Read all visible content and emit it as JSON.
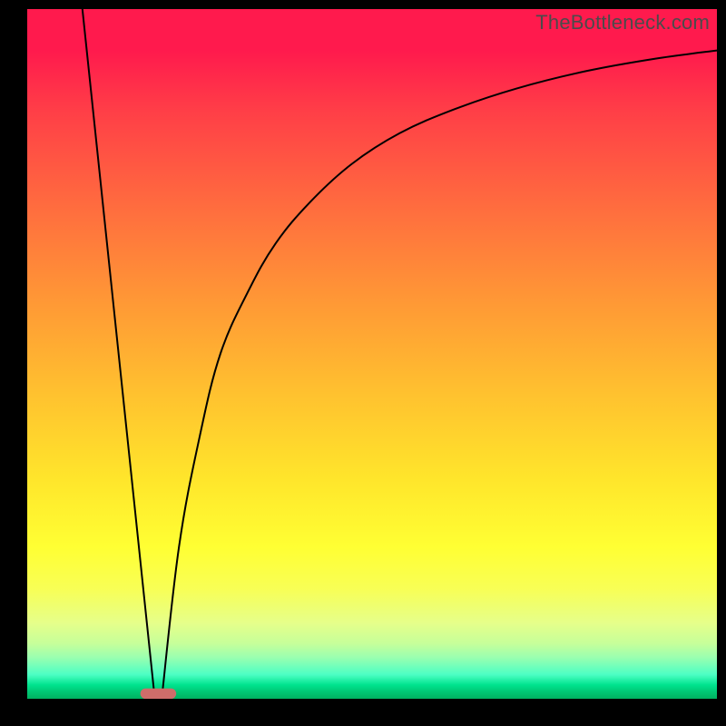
{
  "watermark": "TheBottleneck.com",
  "chart_data": {
    "type": "line",
    "title": "",
    "xlabel": "",
    "ylabel": "",
    "xlim": [
      0,
      100
    ],
    "ylim": [
      0,
      100
    ],
    "series": [
      {
        "name": "left-line",
        "x": [
          8,
          18.5
        ],
        "values": [
          100,
          0
        ]
      },
      {
        "name": "right-curve",
        "x": [
          19.5,
          22,
          25,
          28,
          32,
          36,
          41,
          47,
          54,
          62,
          71,
          81,
          91,
          100
        ],
        "values": [
          0,
          22,
          38,
          50,
          59,
          66,
          72,
          77.5,
          82,
          85.5,
          88.5,
          91,
          92.8,
          94
        ]
      }
    ],
    "marker": {
      "name": "bottom-marker",
      "x": 19,
      "y": 0,
      "width_pct": 5.2,
      "height_pct": 1.5,
      "color": "#cf6d6a"
    }
  }
}
